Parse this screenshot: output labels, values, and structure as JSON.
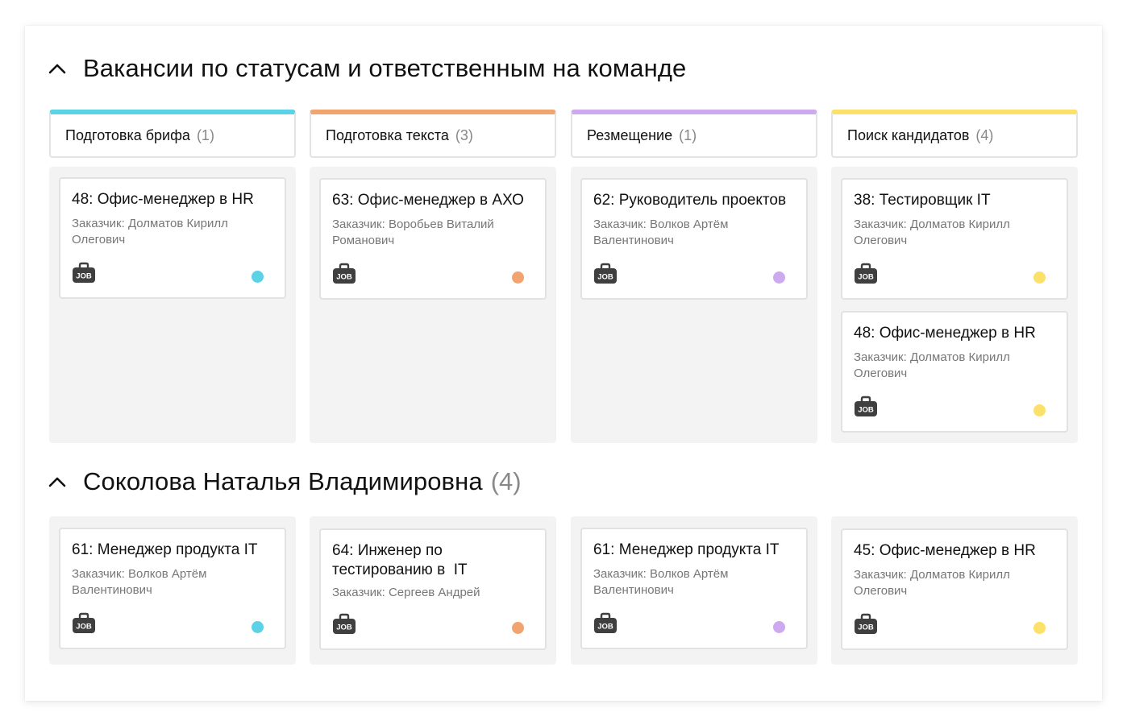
{
  "colors": {
    "brief": "#5bd2e6",
    "text": "#f2a470",
    "placement": "#cdaaf0",
    "search": "#fbe069"
  },
  "section1": {
    "title": "Вакансии по статусам и ответственным на команде",
    "columns": [
      {
        "name": "Подготовка брифа",
        "count": "(1)"
      },
      {
        "name": "Подготовка текста",
        "count": "(3)"
      },
      {
        "name": "Резмещение",
        "count": "(1)"
      },
      {
        "name": "Поиск кандидатов",
        "count": "(4)"
      }
    ],
    "cards": [
      {
        "title": "48: Офис-менеджер в HR",
        "customer": "Заказчик: Долматов Кирилл Олегович",
        "icon": "job-briefcase-icon"
      },
      {
        "title": "63: Офис-менеджер в АХО",
        "customer": "Заказчик: Воробьев Виталий Романович",
        "icon": "job-briefcase-icon"
      },
      {
        "title": "62: Руководитель проектов",
        "customer": "Заказчик: Волков Артём Валентинович",
        "icon": "job-briefcase-icon"
      },
      {
        "title": "38: Тестировщик IT",
        "customer": "Заказчик: Долматов Кирилл Олегович",
        "icon": "job-briefcase-icon"
      },
      {
        "title": "48: Офис-менеджер в HR",
        "customer": "Заказчик: Долматов Кирилл Олегович",
        "icon": "job-briefcase-icon"
      }
    ]
  },
  "section2": {
    "title": "Соколова Наталья Владимировна",
    "count": "(4)",
    "cards": [
      {
        "title": "61: Менеджер продукта IT",
        "customer": "Заказчик: Волков Артём Валентинович",
        "icon": "job-briefcase-icon"
      },
      {
        "title": "64: Инженер по тестированию в  IT",
        "customer": "Заказчик: Сергеев Андрей",
        "icon": "job-briefcase-icon"
      },
      {
        "title": "61: Менеджер продукта IT",
        "customer": "Заказчик: Волков Артём Валентинович",
        "icon": "job-briefcase-icon"
      },
      {
        "title": "45: Офис-менеджер в HR",
        "customer": "Заказчик: Долматов Кирилл Олегович",
        "icon": "job-briefcase-icon"
      }
    ]
  },
  "job_icon_label": "JOB"
}
